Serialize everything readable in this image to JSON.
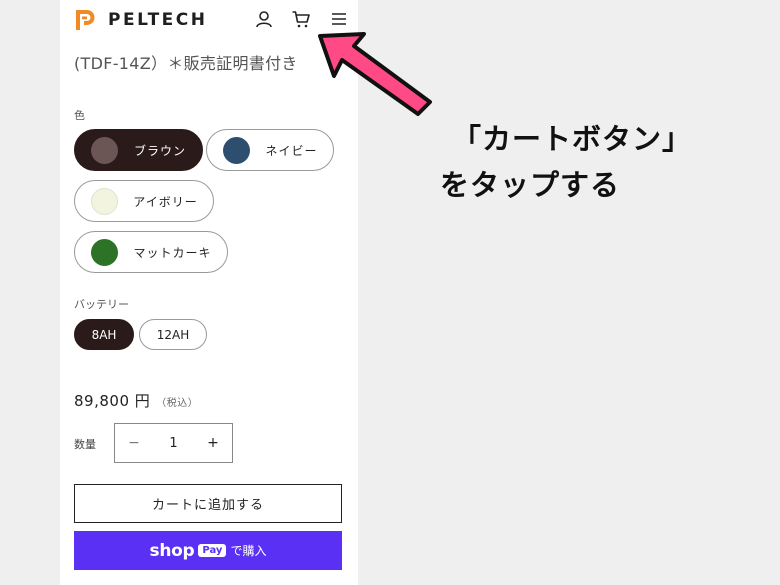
{
  "header": {
    "brand": "PELTECH",
    "brand_color": "#f08a24",
    "icons": [
      "account-icon",
      "cart-icon",
      "menu-icon"
    ]
  },
  "product": {
    "subtitle": "(TDF-14Z）＊販売証明書付き"
  },
  "color_section": {
    "label": "色",
    "options": [
      {
        "label": "ブラウン",
        "swatch": "#6b5555",
        "selected": true
      },
      {
        "label": "ネイビー",
        "swatch": "#2d4e6e",
        "selected": false
      },
      {
        "label": "アイボリー",
        "swatch": "#f2f4e0",
        "selected": false
      },
      {
        "label": "マットカーキ",
        "swatch": "#2c7328",
        "selected": false
      }
    ]
  },
  "battery_section": {
    "label": "バッテリー",
    "options": [
      {
        "label": "8AH",
        "selected": true
      },
      {
        "label": "12AH",
        "selected": false
      }
    ]
  },
  "price": {
    "amount": "89,800 円",
    "tax_note": "（税込）"
  },
  "quantity": {
    "label": "数量",
    "minus": "−",
    "value": "1",
    "plus": "+"
  },
  "actions": {
    "add_to_cart": "カートに追加する",
    "shop_pay_word": "shop",
    "shop_pay_badge": "Pay",
    "shop_pay_suffix": "で購入",
    "shop_pay_color": "#5a31f4"
  },
  "annotation": {
    "line1": "「カートボタン」",
    "line2": "をタップする",
    "arrow_color": "#ff4a86"
  }
}
